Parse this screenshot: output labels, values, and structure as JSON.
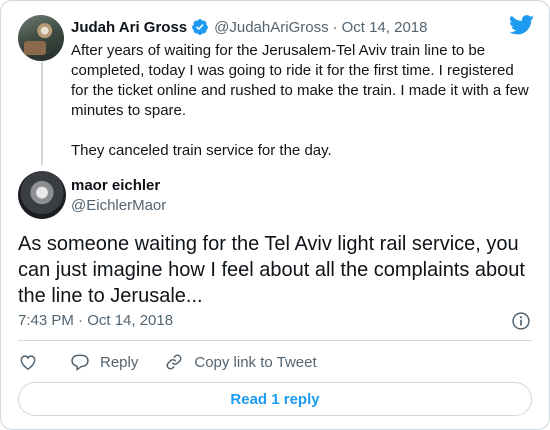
{
  "tweet": {
    "author_name": "Judah Ari Gross",
    "handle": "@JudahAriGross",
    "separator": "·",
    "date": "Oct 14, 2018",
    "paragraphs": [
      "After years of waiting for the Jerusalem-Tel Aviv train line to be completed, today I was going to ride it for the first time. I registered for the ticket online and rushed to make the train. I made it with a few minutes to spare.",
      "They canceled train service for the day."
    ]
  },
  "reply_tweet": {
    "author_name": "maor eichler",
    "handle": "@EichlerMaor",
    "text": "As someone waiting for the Tel Aviv light rail service, you can just imagine how I feel about all the complaints about the line to Jerusale...",
    "timestamp": "7:43 PM · Oct 14, 2018"
  },
  "actions": {
    "reply_label": "Reply",
    "copy_link_label": "Copy link to Tweet"
  },
  "read_replies_label": "Read 1 reply",
  "colors": {
    "brand_blue": "#1d9bf0",
    "text_primary": "#0f1419",
    "text_secondary": "#536471",
    "border": "#cfd9de"
  },
  "icons": [
    "twitter-logo-icon",
    "verified-badge-icon",
    "info-icon",
    "heart-icon",
    "reply-icon",
    "link-icon"
  ]
}
